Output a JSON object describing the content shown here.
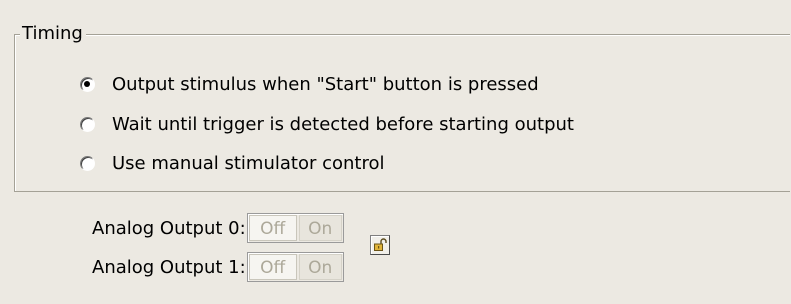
{
  "timing": {
    "title": "Timing",
    "options": [
      {
        "label": "Output stimulus when \"Start\" button is pressed",
        "selected": true
      },
      {
        "label": "Wait until trigger is detected before starting output",
        "selected": false
      },
      {
        "label": "Use manual stimulator control",
        "selected": false
      }
    ]
  },
  "analog_outputs": [
    {
      "label": "Analog Output 0:",
      "off_label": "Off",
      "on_label": "On"
    },
    {
      "label": "Analog Output 1:",
      "off_label": "Off",
      "on_label": "On"
    }
  ],
  "icons": {
    "lock": "padlock-unlocked-icon"
  }
}
